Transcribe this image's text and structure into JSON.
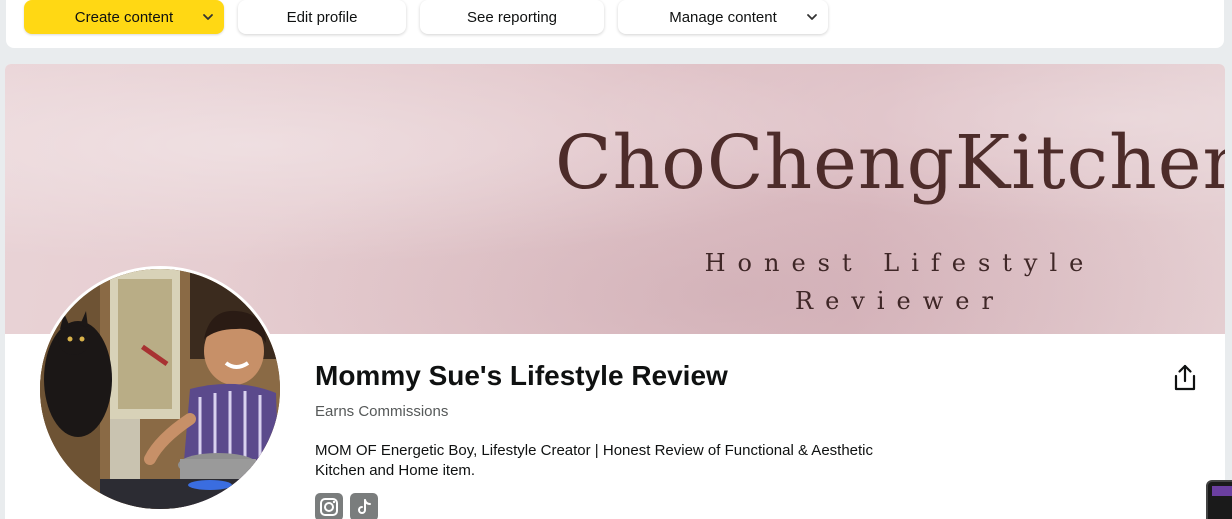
{
  "toolbar": {
    "create_label": "Create content",
    "edit_label": "Edit profile",
    "report_label": "See reporting",
    "manage_label": "Manage content",
    "dropdown_icon": "chevron-down-icon",
    "primary_color": "#ffd814"
  },
  "banner": {
    "title": "ChoChengKitchen",
    "subtitle": "Honest Lifestyle Reviewer",
    "background_color": "#e3c8cc",
    "text_color": "#4d2c2a"
  },
  "profile": {
    "avatar": "profile-photo",
    "name": "Mommy Sue's Lifestyle Review",
    "status": "Earns Commissions",
    "bio": "MOM OF Energetic Boy, Lifestyle Creator | Honest Review of Functional & Aesthetic Kitchen and Home item.",
    "social_links": [
      "instagram-icon",
      "tiktok-icon"
    ],
    "share_icon": "share-icon"
  }
}
